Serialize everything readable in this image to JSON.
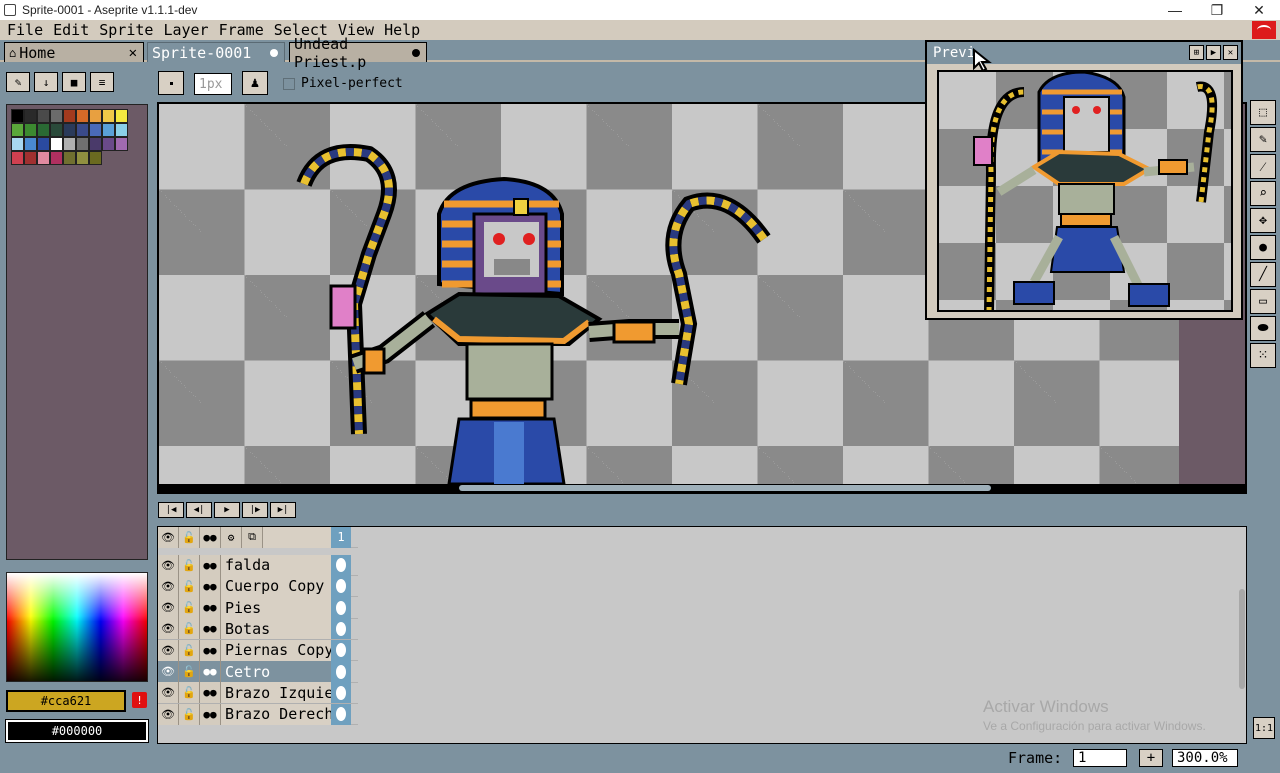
{
  "window": {
    "title": "Sprite-0001 - Aseprite v1.1.1-dev",
    "controls": [
      "—",
      "❐",
      "✕"
    ]
  },
  "menu": [
    "File",
    "Edit",
    "Sprite",
    "Layer",
    "Frame",
    "Select",
    "View",
    "Help"
  ],
  "tabs": [
    {
      "label": "Home",
      "icon": "home-icon"
    },
    {
      "label": "Sprite-0001"
    },
    {
      "label": "Undead Priest.p"
    }
  ],
  "context_bar": {
    "brush_size": "1px",
    "pixel_perfect_label": "Pixel-perfect"
  },
  "palette": {
    "colors": [
      "#000000",
      "#2a2a2a",
      "#4a4a4a",
      "#6b6b6b",
      "#a33a1e",
      "#d66a28",
      "#e8a040",
      "#f0c848",
      "#f4e840",
      "#5aa83a",
      "#3c8a30",
      "#2a6a34",
      "#2a4a3a",
      "#2a3a5a",
      "#3a4a8a",
      "#4a6ab8",
      "#5aa0d8",
      "#8ad0e8",
      "#a8d8f0",
      "#4a8ad0",
      "#2a4aa0",
      "#ffffff",
      "#b0b0b0",
      "#707070",
      "#4a3a6a",
      "#6a4a8a",
      "#a06ab0",
      "#d04050",
      "#a03030",
      "#e08aa0",
      "#b03060",
      "#707030",
      "#909040",
      "#6a6a20"
    ]
  },
  "colors": {
    "foreground": "#cca621",
    "background": "#000000",
    "warning": "!"
  },
  "timeline": {
    "header_frame": "1",
    "layers": [
      {
        "name": "falda"
      },
      {
        "name": "Cuerpo Copy"
      },
      {
        "name": "Pies"
      },
      {
        "name": "Botas"
      },
      {
        "name": "Piernas Copy ("
      },
      {
        "name": "Cetro",
        "selected": true
      },
      {
        "name": "Brazo Izquierd"
      },
      {
        "name": "Brazo Derecho"
      }
    ]
  },
  "watermark": {
    "line1": "Activar Windows",
    "line2": "Ve a Configuración para activar Windows."
  },
  "status": {
    "frame_label": "Frame:",
    "frame_value": "1",
    "zoom": "300.0%",
    "one_to_one": "1:1"
  },
  "preview": {
    "title": "Previ"
  },
  "tools": [
    "marquee-icon",
    "pencil-icon",
    "eyedropper-icon",
    "zoom-icon",
    "move-icon",
    "paint-bucket-icon",
    "line-icon",
    "rectangle-icon",
    "ellipse-icon",
    "spray-icon"
  ]
}
